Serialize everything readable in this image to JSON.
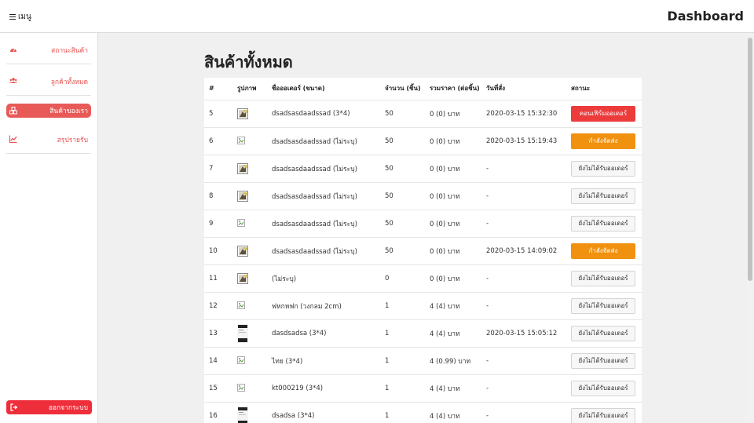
{
  "header": {
    "menu_label": "เมนู",
    "app_title": "Dashboard"
  },
  "sidebar": {
    "items": [
      {
        "label": "สถานะสินค้า",
        "icon": "tachometer-icon",
        "active": false
      },
      {
        "label": "ลูกค้าทั้งหมด",
        "icon": "users-icon",
        "active": false
      },
      {
        "label": "สินค้าของเรา",
        "icon": "cubes-icon",
        "active": true
      },
      {
        "label": "สรุปรายรับ",
        "icon": "line-chart-icon",
        "active": false
      }
    ],
    "logout_label": "ออกจากระบบ",
    "colors": {
      "accent": "#e8504e",
      "active_bg": "#e75a58",
      "logout_bg": "#ee2e3a"
    }
  },
  "main": {
    "title": "สินค้าทั้งหมด",
    "table": {
      "headers": [
        "#",
        "รูปภาพ",
        "ชื่อออเดอร์ (ขนาด)",
        "จำนวน (ชิ้น)",
        "รวมราคา (ต่อชิ้น)",
        "วันที่สั่ง",
        "สถานะ"
      ],
      "rows": [
        {
          "id": "5",
          "image": "photo",
          "name": "dsadsasdaadssad (3*4)",
          "qty": "50",
          "price": "0 (0) บาท",
          "date": "2020-03-15 15:32:30",
          "status": "คอนเฟิร์มออเดอร์",
          "status_type": "red"
        },
        {
          "id": "6",
          "image": "broken",
          "name": "dsadsasdaadssad (ไม่ระบุ)",
          "qty": "50",
          "price": "0 (0) บาท",
          "date": "2020-03-15 15:19:43",
          "status": "กำลังจัดส่ง",
          "status_type": "orange"
        },
        {
          "id": "7",
          "image": "photo",
          "name": "dsadsasdaadssad (ไม่ระบุ)",
          "qty": "50",
          "price": "0 (0) บาท",
          "date": "-",
          "status": "ยังไม่ได้รับออเดอร์",
          "status_type": "gray"
        },
        {
          "id": "8",
          "image": "photo",
          "name": "dsadsasdaadssad (ไม่ระบุ)",
          "qty": "50",
          "price": "0 (0) บาท",
          "date": "-",
          "status": "ยังไม่ได้รับออเดอร์",
          "status_type": "gray"
        },
        {
          "id": "9",
          "image": "broken",
          "name": "dsadsasdaadssad (ไม่ระบุ)",
          "qty": "50",
          "price": "0 (0) บาท",
          "date": "-",
          "status": "ยังไม่ได้รับออเดอร์",
          "status_type": "gray"
        },
        {
          "id": "10",
          "image": "photo",
          "name": "dsadsasdaadssad (ไม่ระบุ)",
          "qty": "50",
          "price": "0 (0) บาท",
          "date": "2020-03-15 14:09:02",
          "status": "กำลังจัดส่ง",
          "status_type": "orange"
        },
        {
          "id": "11",
          "image": "photo",
          "name": "(ไม่ระบุ)",
          "qty": "0",
          "price": "0 (0) บาท",
          "date": "-",
          "status": "ยังไม่ได้รับออเดอร์",
          "status_type": "gray"
        },
        {
          "id": "12",
          "image": "broken",
          "name": "ฟหกหฟก (วงกลม 2cm)",
          "qty": "1",
          "price": "4 (4) บาท",
          "date": "-",
          "status": "ยังไม่ได้รับออเดอร์",
          "status_type": "gray"
        },
        {
          "id": "13",
          "image": "document",
          "name": "dasdsadsa (3*4)",
          "qty": "1",
          "price": "4 (4) บาท",
          "date": "2020-03-15 15:05:12",
          "status": "ยังไม่ได้รับออเดอร์",
          "status_type": "gray"
        },
        {
          "id": "14",
          "image": "broken",
          "name": "ไทย (3*4)",
          "qty": "1",
          "price": "4 (0.99) บาท",
          "date": "-",
          "status": "ยังไม่ได้รับออเดอร์",
          "status_type": "gray"
        },
        {
          "id": "15",
          "image": "broken",
          "name": "kt000219 (3*4)",
          "qty": "1",
          "price": "4 (4) บาท",
          "date": "-",
          "status": "ยังไม่ได้รับออเดอร์",
          "status_type": "gray"
        },
        {
          "id": "16",
          "image": "document",
          "name": "dsadsa (3*4)",
          "qty": "1",
          "price": "4 (4) บาท",
          "date": "-",
          "status": "ยังไม่ได้รับออเดอร์",
          "status_type": "gray"
        }
      ]
    }
  }
}
